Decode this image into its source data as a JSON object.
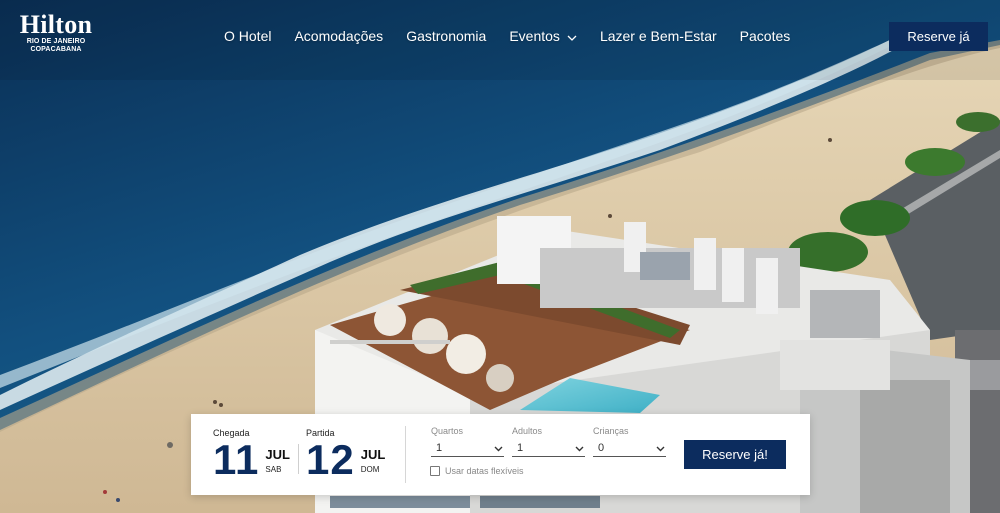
{
  "brand": {
    "name": "Hilton",
    "sub_line1": "RIO DE JANEIRO",
    "sub_line2": "COPACABANA"
  },
  "nav": {
    "items": [
      {
        "label": "O Hotel"
      },
      {
        "label": "Acomodações"
      },
      {
        "label": "Gastronomia"
      },
      {
        "label": "Eventos",
        "icon": "chevron-down-icon"
      },
      {
        "label": "Lazer e Bem-Estar"
      },
      {
        "label": "Pacotes"
      }
    ],
    "reserve_label": "Reserve já"
  },
  "booking": {
    "checkin": {
      "label": "Chegada",
      "day": "11",
      "month": "JUL",
      "weekday": "SAB"
    },
    "checkout": {
      "label": "Partida",
      "day": "12",
      "month": "JUL",
      "weekday": "DOM"
    },
    "rooms": {
      "label": "Quartos",
      "value": "1"
    },
    "adults": {
      "label": "Adultos",
      "value": "1"
    },
    "children": {
      "label": "Crianças",
      "value": "0"
    },
    "flexible_label": "Usar datas flexíveis",
    "flexible_checked": false,
    "submit_label": "Reserve já!"
  },
  "colors": {
    "primary": "#0c2c5e",
    "ocean": "#0f4a78",
    "sand": "#dcc7a4"
  }
}
